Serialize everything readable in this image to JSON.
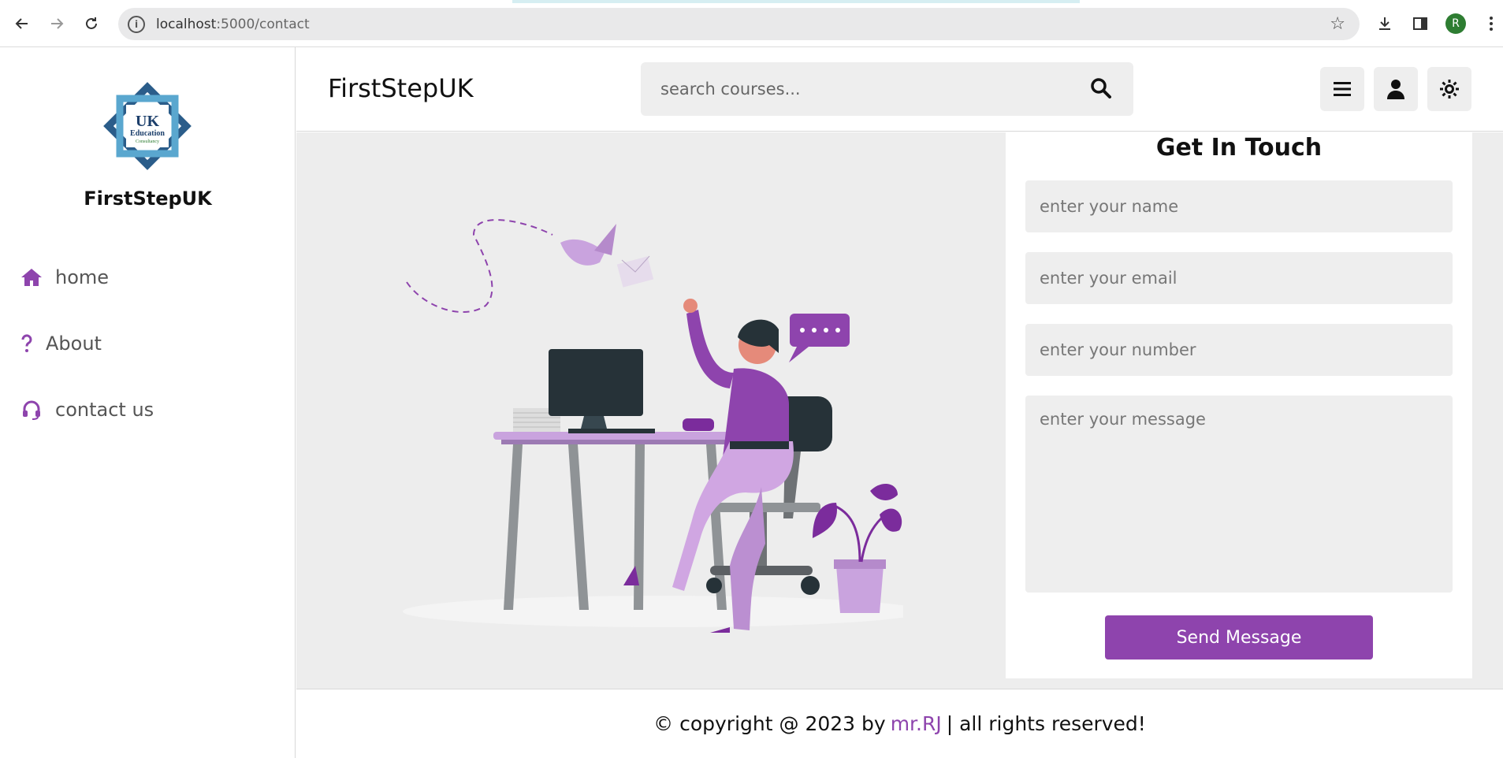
{
  "browser": {
    "url_host": "localhost",
    "url_path": ":5000/contact",
    "avatar_letter": "R",
    "icons": [
      "back-arrow-icon",
      "forward-arrow-icon",
      "reload-icon",
      "info-icon",
      "star-icon",
      "download-icon",
      "side-panel-icon"
    ]
  },
  "sidebar": {
    "brand": "FirstStepUK",
    "logo_text": {
      "line1": "UK",
      "line2": "Education",
      "line3": "Consultancy"
    },
    "items": [
      {
        "label": "home",
        "icon": "home-icon"
      },
      {
        "label": "About",
        "icon": "question-icon"
      },
      {
        "label": "contact us",
        "icon": "headset-icon"
      }
    ]
  },
  "header": {
    "title": "FirstStepUK",
    "search_placeholder": "search courses...",
    "icons": [
      "search-icon",
      "menu-icon",
      "user-icon",
      "theme-toggle-icon"
    ]
  },
  "contact": {
    "title": "Get In Touch",
    "name_placeholder": "enter your name",
    "email_placeholder": "enter your email",
    "number_placeholder": "enter your number",
    "message_placeholder": "enter your message",
    "send_label": "Send Message"
  },
  "footer": {
    "prefix": "© copyright @ 2023 by",
    "author": "mr.RJ",
    "suffix": "| all rights reserved!"
  },
  "colors": {
    "accent": "#8e44ad",
    "background": "#ededed",
    "field": "#eeeeee"
  }
}
